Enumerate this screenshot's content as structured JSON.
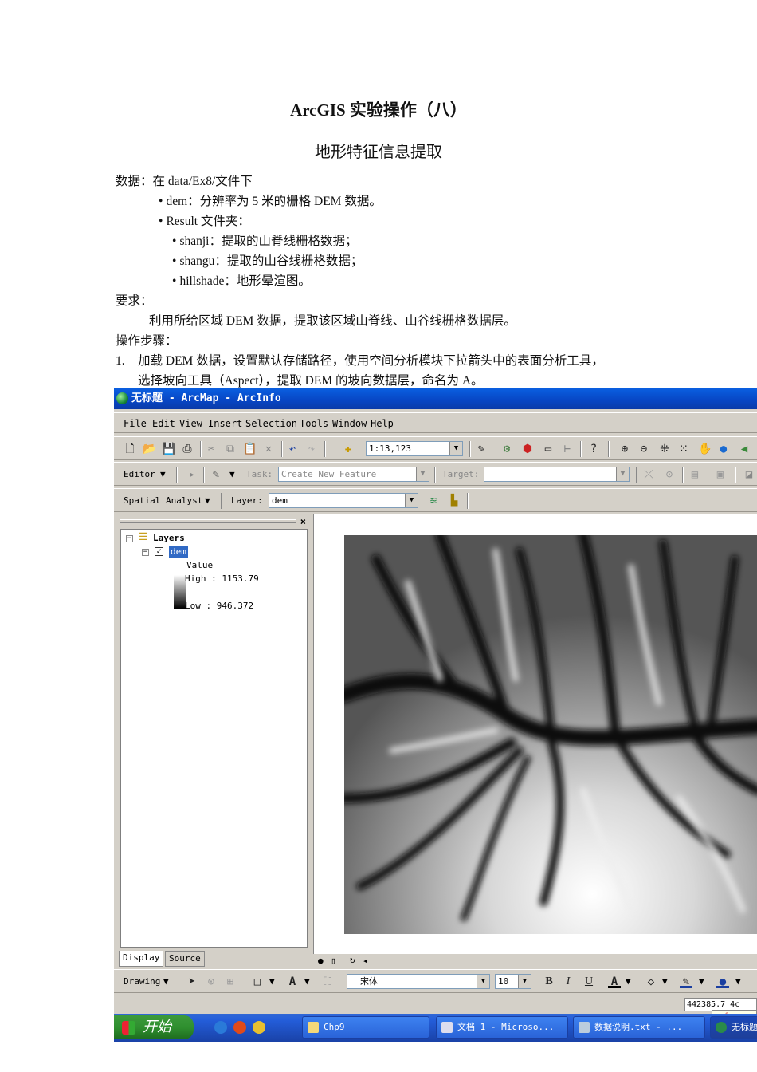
{
  "doc": {
    "title": "ArcGIS 实验操作（八）",
    "subtitle": "地形特征信息提取",
    "lines": [
      "数据：在 data/Ex8/文件下",
      "dem：分辨率为 5 米的栅格 DEM 数据。",
      "Result 文件夹：",
      "shanji：提取的山脊线栅格数据；",
      "shangu：提取的山谷线栅格数据；",
      "hillshade：地形晕渲图。",
      "要求：",
      "利用所给区域 DEM 数据，提取该区域山脊线、山谷线栅格数据层。",
      "操作步骤：",
      "1.",
      "加载 DEM 数据，设置默认存储路径，使用空间分析模块下拉箭头中的表面分析工具，",
      "选择坡向工具（Aspect），提取 DEM 的坡向数据层，命名为 A。"
    ]
  },
  "app": {
    "title": "无标题 - ArcMap - ArcInfo",
    "menu": [
      "File",
      "Edit",
      "View",
      "Insert",
      "Selection",
      "Tools",
      "Window",
      "Help"
    ],
    "scale": "1:13,123",
    "editor_label": "Editor",
    "task_label": "Task:",
    "task_value": "Create New Feature",
    "target_label": "Target:",
    "spatial_analyst_label": "Spatial Analyst",
    "layer_label": "Layer:",
    "layer_value": "dem",
    "toc": {
      "root": "Layers",
      "layer": "dem",
      "legend_title": "Value",
      "high": "High : 1153.79",
      "low": "Low : 946.372"
    },
    "tabs": [
      "Display",
      "Source"
    ],
    "drawing_label": "Drawing",
    "font_name": "宋体",
    "font_size": "10",
    "bold": "B",
    "italic": "I",
    "underline": "U",
    "coord": "442385.7  4c",
    "taskbar": {
      "start": "开始",
      "items": [
        "Chp9",
        "文档 1 - Microso...",
        "数据说明.txt - ...",
        "无标题"
      ]
    }
  },
  "colors": {
    "titlebar": "#0a5fe0",
    "chrome": "#d4d0c8",
    "taskbar": "#245edb",
    "start": "#2f8f2f"
  }
}
